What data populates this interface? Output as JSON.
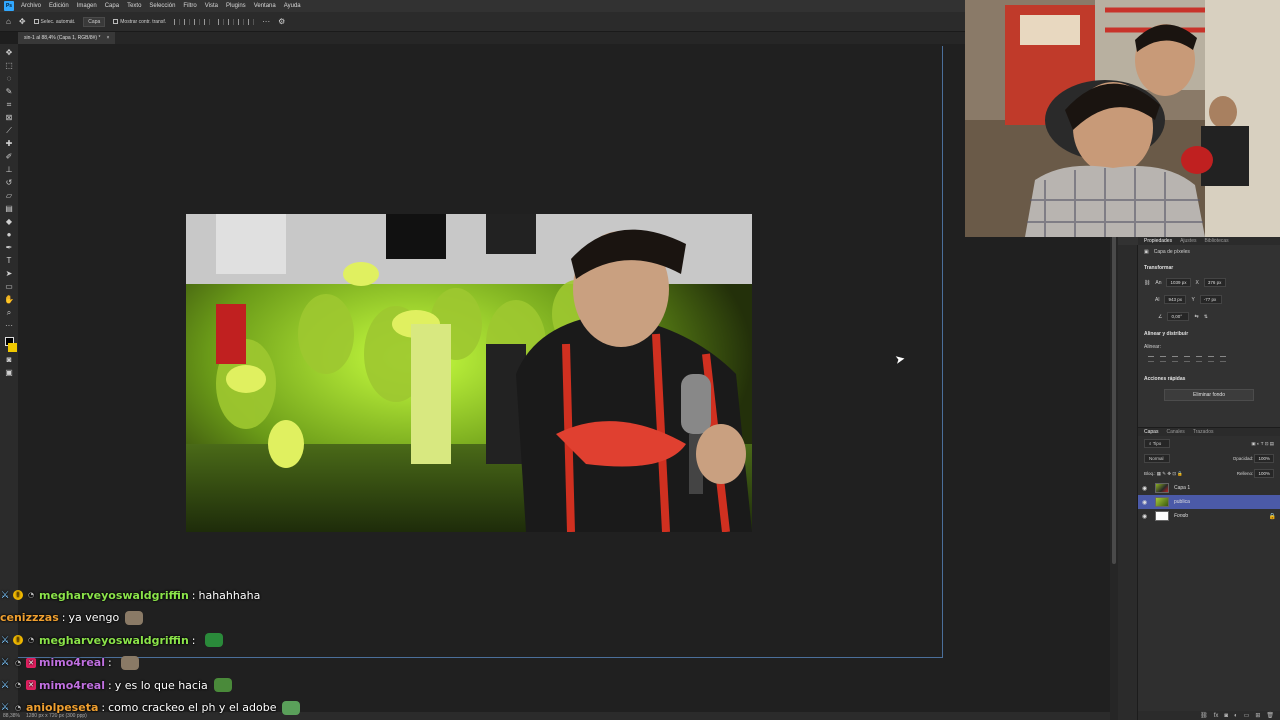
{
  "menu": [
    "Archivo",
    "Edición",
    "Imagen",
    "Capa",
    "Texto",
    "Selección",
    "Filtro",
    "Vista",
    "Plugins",
    "Ventana",
    "Ayuda"
  ],
  "options": {
    "auto_select": "Selec. automát.",
    "auto_select_target": "Capa",
    "show_transform": "Mostrar contr. transf."
  },
  "document_tab": {
    "title": "sin-1 al 88,4% (Capa 1, RGB/8#) *",
    "close": "×"
  },
  "status": {
    "zoom": "88,38%",
    "size": "1280 px x 720 px (300 ppp)"
  },
  "properties": {
    "tabs": [
      "Propiedades",
      "Ajustes",
      "Bibliotecas"
    ],
    "layer_type": "Capa de píxeles",
    "transform_header": "Transformar",
    "width_label": "An",
    "width": "1039 px",
    "x_label": "X",
    "x": "376 px",
    "height_label": "Al",
    "height": "943 px",
    "y_label": "Y",
    "y": "-77 px",
    "angle": "0,00°",
    "align_header": "Alinear y distribuir",
    "align_sub": "Alinear:",
    "quick_header": "Acciones rápidas",
    "remove_bg": "Eliminar fondo"
  },
  "layers": {
    "tabs": [
      "Capas",
      "Canales",
      "Trazados"
    ],
    "filter": "Tipo",
    "blend": "Normal",
    "opacity_label": "Opacidad:",
    "opacity": "100%",
    "lock_label": "Bloq.:",
    "fill_label": "Relleno:",
    "fill": "100%",
    "items": [
      {
        "name": "Capa 1",
        "selected": false
      },
      {
        "name": "publica",
        "selected": true
      },
      {
        "name": "Fondo",
        "selected": false
      }
    ]
  },
  "chat": [
    {
      "user": "megharveyoswaldgriffin",
      "color": "#8be34a",
      "text": "hahahhaha",
      "badges": [
        "sword",
        "coin",
        "grey"
      ],
      "emote": ""
    },
    {
      "user": "cenizzzas",
      "color": "#f0a030",
      "text": "ya vengo",
      "badges": [],
      "emote": "#8a7a66"
    },
    {
      "user": "megharveyoswaldgriffin",
      "color": "#8be34a",
      "text": "",
      "badges": [
        "sword",
        "coin",
        "grey"
      ],
      "emote": "#2a8a3a"
    },
    {
      "user": "mimo4real",
      "color": "#c070e0",
      "text": "",
      "badges": [
        "sword",
        "grey",
        "vip"
      ],
      "emote": "#8a7a66"
    },
    {
      "user": "mimo4real",
      "color": "#c070e0",
      "text": "y es lo que hacia",
      "badges": [
        "sword",
        "grey",
        "vip"
      ],
      "emote": "#4a8a3a"
    },
    {
      "user": "aniolpeseta",
      "color": "#f0a030",
      "text": "como crackeo el ph y el adobe",
      "badges": [
        "sword",
        "grey"
      ],
      "emote": "#5aa05a"
    }
  ],
  "colors": {
    "accent": "#31a8ff",
    "selection": "#4b5aa8",
    "foreground": "#000000",
    "background": "#f0c800"
  }
}
